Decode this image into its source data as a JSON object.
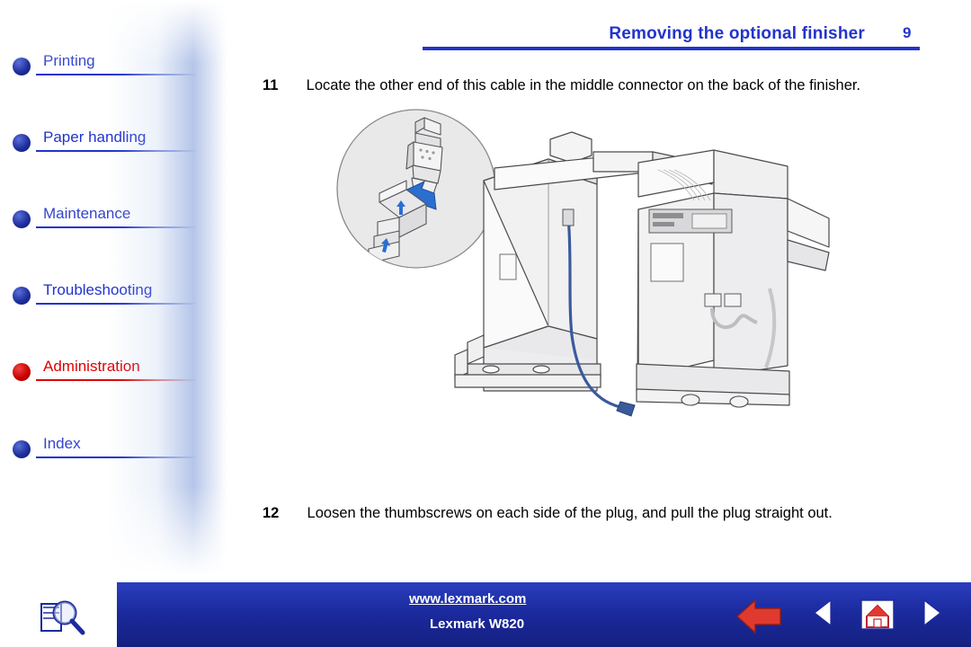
{
  "header": {
    "title": "Removing the optional finisher",
    "page_number": "9"
  },
  "sidebar": {
    "items": [
      {
        "label": "Printing",
        "icon": "bullet-blue",
        "color": "#3344cc"
      },
      {
        "label": "Paper handling",
        "icon": "bullet-blue",
        "color": "#2233cc"
      },
      {
        "label": "Maintenance",
        "icon": "bullet-blue",
        "color": "#3344cc"
      },
      {
        "label": "Troubleshooting",
        "icon": "bullet-blue",
        "color": "#2233cc"
      },
      {
        "label": "Administration",
        "icon": "bullet-red",
        "color": "#dd0000"
      },
      {
        "label": "Index",
        "icon": "bullet-blue",
        "color": "#3344cc"
      }
    ]
  },
  "main": {
    "steps": [
      {
        "number": "11",
        "text": "Locate the other end of this cable in the middle connector on the back of the finisher."
      },
      {
        "number": "12",
        "text": "Loosen the thumbscrews on each side of the plug, and pull the plug straight out."
      }
    ],
    "figure_alt": "Illustration of printer and optional finisher with cable connector callout"
  },
  "footer": {
    "url": "www.lexmark.com",
    "brand": "Lexmark W820",
    "buttons": [
      {
        "name": "search-icon",
        "label": ""
      },
      {
        "name": "back-arrow",
        "label": ""
      },
      {
        "name": "previous-page",
        "label": ""
      },
      {
        "name": "home-icon",
        "label": ""
      },
      {
        "name": "next-page",
        "label": ""
      }
    ]
  },
  "colors": {
    "brand_blue": "#2233cc",
    "accent_red": "#dd0000",
    "footer_bg": "#1b2a9e"
  }
}
